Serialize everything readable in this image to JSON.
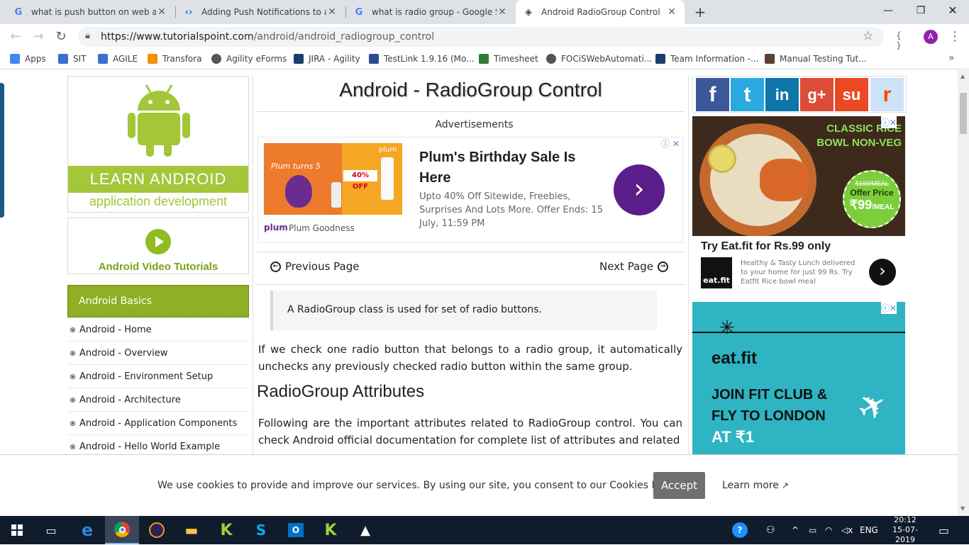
{
  "browser": {
    "tabs": [
      {
        "title": "what is push button on web appl",
        "icon": "google-g-icon",
        "active": false
      },
      {
        "title": "Adding Push Notifications to a W",
        "icon": "codelabs-icon",
        "active": false
      },
      {
        "title": "what is radio group - Google Sea",
        "icon": "google-g-icon",
        "active": false
      },
      {
        "title": "Android RadioGroup Control",
        "icon": "tutorialspoint-icon",
        "active": true
      }
    ],
    "new_tab": "+",
    "url_host": "https://www.tutorialspoint.com",
    "url_path": "/android/android_radiogroup_control",
    "profile_initial": "A",
    "bookmarks": [
      {
        "label": "Apps",
        "icon": "apps-grid-icon",
        "color": "#4285f4"
      },
      {
        "label": "SIT",
        "icon": "bookmark-page-icon",
        "color": "#3b6ecf"
      },
      {
        "label": "AGILE",
        "icon": "bookmark-page-icon",
        "color": "#3b6ecf"
      },
      {
        "label": "Transfora",
        "icon": "transfora-icon",
        "color": "#f29000"
      },
      {
        "label": "Agility eForms",
        "icon": "globe-icon",
        "color": "#555555"
      },
      {
        "label": "JIRA - Agility",
        "icon": "jira-icon",
        "color": "#1d3c6e"
      },
      {
        "label": "TestLink 1.9.16 (Mo...",
        "icon": "testlink-icon",
        "color": "#2a4d8f"
      },
      {
        "label": "Timesheet",
        "icon": "timesheet-icon",
        "color": "#2e7d32"
      },
      {
        "label": "FOCiSWebAutomati...",
        "icon": "globe-icon",
        "color": "#555555"
      },
      {
        "label": "Team Information -...",
        "icon": "team-icon",
        "color": "#1d3c6e"
      },
      {
        "label": "Manual Testing Tut...",
        "icon": "book-icon",
        "color": "#5d4037"
      }
    ]
  },
  "left": {
    "banner_title": "LEARN ANDROID",
    "banner_subtitle": "application development",
    "video_label": "Android Video Tutorials",
    "section_title": "Android Basics",
    "items": [
      "Android - Home",
      "Android - Overview",
      "Android - Environment Setup",
      "Android - Architecture",
      "Android - Application Components",
      "Android - Hello World Example"
    ]
  },
  "article": {
    "title": "Android - RadioGroup Control",
    "ads_label": "Advertisements",
    "ad": {
      "headline": "Plum's Birthday Sale Is Here",
      "body": "Upto 40% Off Sitewide, Freebies, Surprises And Lots More. Offer Ends: 15 July, 11:59 PM",
      "brand": "Plum Goodness",
      "brand_logo": "plum",
      "image_text1": "Plum turns 5",
      "image_text2": "40% OFF",
      "image_logo": "plum"
    },
    "prev_label": "Previous Page",
    "next_label": "Next Page",
    "note": "A RadioGroup class is used for set of radio buttons.",
    "para1": "If we check one radio button that belongs to a radio group, it automatically unchecks any previously checked radio button within the same group.",
    "h2": "RadioGroup Attributes",
    "para2": "Following are the important attributes related to RadioGroup control. You can check Android official documentation for complete list of attributes and related"
  },
  "right": {
    "social": [
      {
        "name": "facebook",
        "glyph": "f",
        "color": "#3b5998"
      },
      {
        "name": "twitter",
        "glyph": "t",
        "color": "#2aa9e0"
      },
      {
        "name": "linkedin",
        "glyph": "in",
        "color": "#0e76a8"
      },
      {
        "name": "google-plus",
        "glyph": "g+",
        "color": "#dd4b39"
      },
      {
        "name": "stumbleupon",
        "glyph": "su",
        "color": "#eb4924"
      },
      {
        "name": "reddit",
        "glyph": "r",
        "color": "#cee3f8"
      }
    ],
    "ad1": {
      "banner_line1": "CLASSIC RICE",
      "banner_line2": "BOWL NON-VEG",
      "price_small": "₹190/MEAL",
      "price_label": "Offer Price",
      "price": "₹99",
      "price_unit": "/MEAL",
      "headline": "Try Eat.fit for Rs.99 only",
      "body": "Healthy & Tasty Lunch delivered to your home for just 99 Rs. Try Eatfit Rice bowl meal",
      "logo": "eat.fit"
    },
    "ad2": {
      "logo": "eat.fit",
      "line1": "JOIN FIT CLUB &",
      "line2": "FLY TO LONDON",
      "line3": "AT ₹1"
    }
  },
  "cookie": {
    "text": "We use cookies to provide and improve our services. By using our site, you consent to our Cookies Policy.",
    "accept": "Accept",
    "learn_more": "Learn more"
  },
  "taskbar": {
    "lang": "ENG",
    "time": "20:12",
    "date": "15-07-2019"
  }
}
